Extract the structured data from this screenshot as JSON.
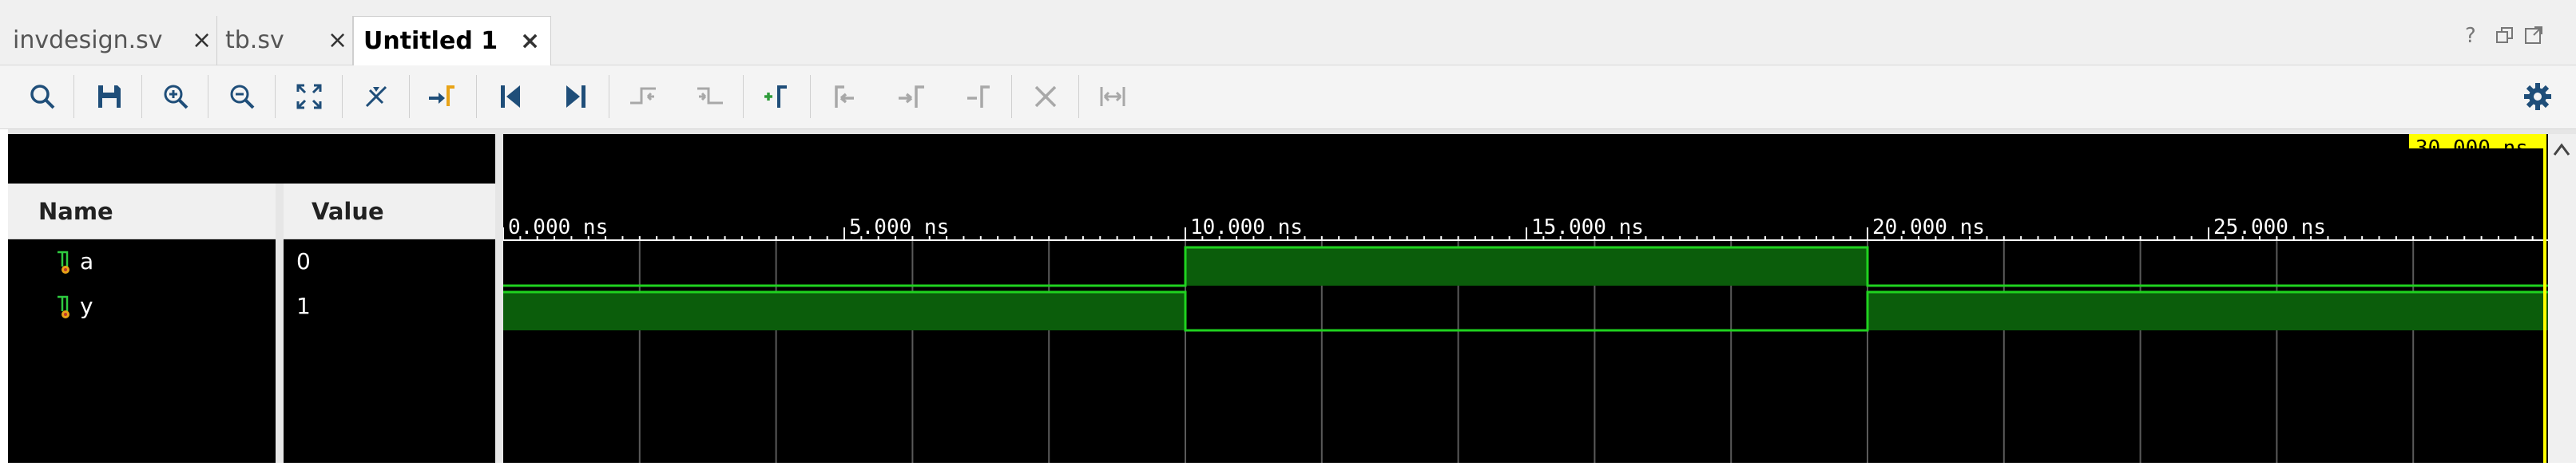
{
  "tabs": [
    {
      "label": "invdesign.sv",
      "active": false
    },
    {
      "label": "tb.sv",
      "active": false
    },
    {
      "label": "Untitled 1",
      "active": true
    }
  ],
  "tab_close_glyph": "×",
  "window_controls": [
    "?",
    "restore-icon",
    "maximize-icon"
  ],
  "toolbar": {
    "buttons": [
      "search-icon",
      "save-icon",
      "zoom-in-icon",
      "zoom-out-icon",
      "zoom-fit-icon",
      "cursor-snap-icon",
      "go-to-time-zero-icon",
      "go-to-start-icon",
      "go-to-end-icon",
      "previous-transition-icon",
      "next-transition-icon",
      "add-marker-icon",
      "previous-marker-icon",
      "next-marker-icon",
      "delete-marker-icon",
      "delete-all-markers-icon",
      "swap-cursors-icon",
      "settings-icon"
    ]
  },
  "columns": {
    "name": "Name",
    "value": "Value"
  },
  "signals": [
    {
      "name": "a",
      "value": "0"
    },
    {
      "name": "y",
      "value": "1"
    }
  ],
  "timeline": {
    "unit": "ns",
    "cursor_label": "30.000 ns",
    "tick_labels": [
      "0.000 ns",
      "5.000 ns",
      "10.000 ns",
      "15.000 ns",
      "20.000 ns",
      "25.000 ns"
    ],
    "visible_range_ns": [
      0,
      30
    ],
    "major_tick_ns": 5,
    "grid_ns": 2,
    "cursor_ns": 30
  },
  "waveforms": [
    {
      "signal": "a",
      "segments": [
        [
          0,
          10,
          0
        ],
        [
          10,
          20,
          1
        ],
        [
          20,
          30,
          0
        ]
      ]
    },
    {
      "signal": "y",
      "segments": [
        [
          0,
          10,
          1
        ],
        [
          10,
          20,
          0
        ],
        [
          20,
          30,
          1
        ]
      ]
    }
  ],
  "colors": {
    "wave_high_fill": "#0b5d0b",
    "wave_line": "#1fd21f",
    "grid": "#5a5a5a",
    "cursor": "#ffff00",
    "ruler_text": "#ffffff"
  }
}
